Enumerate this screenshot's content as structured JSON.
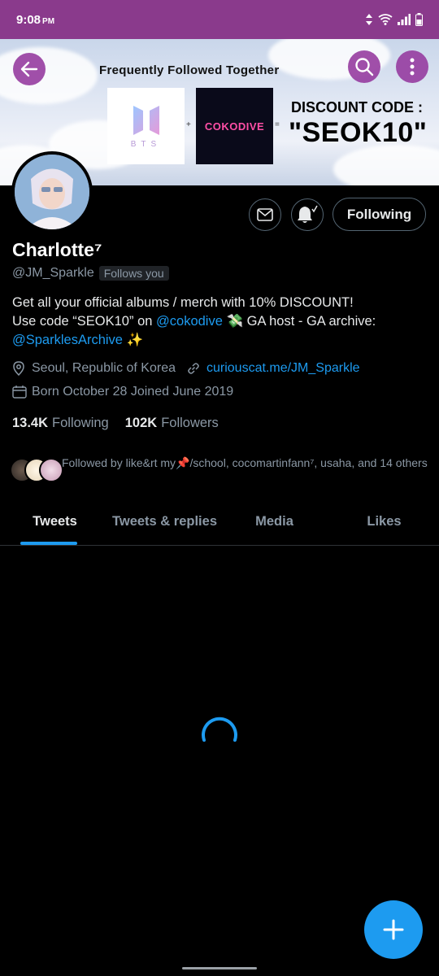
{
  "status_bar": {
    "time": "9:08",
    "ampm": "PM"
  },
  "banner": {
    "title": "Frequently Followed Together",
    "logo_left_text": "BTS",
    "logo_right_text": "COKODIVE",
    "plus": "+",
    "equals": "=",
    "discount_label": "DISCOUNT CODE :",
    "discount_code": "\"SEOK10\""
  },
  "header_buttons": {
    "back": "back-icon",
    "search": "search-icon",
    "more": "more-vertical-icon"
  },
  "profile": {
    "name": "Charlotte⁷",
    "handle": "@JM_Sparkle",
    "follows_you": "Follows you",
    "bio_line1": "Get all your official albums / merch with 10% DISCOUNT!",
    "bio_line2_prefix": "Use code “SEOK10” on ",
    "bio_mention1": "@cokodive",
    "bio_line2_suffix": " 💸 GA host - GA archive:",
    "bio_mention2": "@SparklesArchive",
    "bio_sparkle": " ✨",
    "location": "Seoul, Republic of Korea",
    "website": "curiouscat.me/JM_Sparkle",
    "born_joined": "Born October 28 Joined June 2019",
    "following_count": "13.4K",
    "following_label": "Following",
    "followers_count": "102K",
    "followers_label": "Followers",
    "followed_by": "Followed by like&rt my📌/school, cocomartinfann⁷, usaha, and 14 others",
    "following_button": "Following"
  },
  "tabs": [
    "Tweets",
    "Tweets & replies",
    "Media",
    "Likes"
  ],
  "colors": {
    "accent": "#1d9bf0",
    "statusbar": "#8a3a8c",
    "background": "#000000"
  }
}
